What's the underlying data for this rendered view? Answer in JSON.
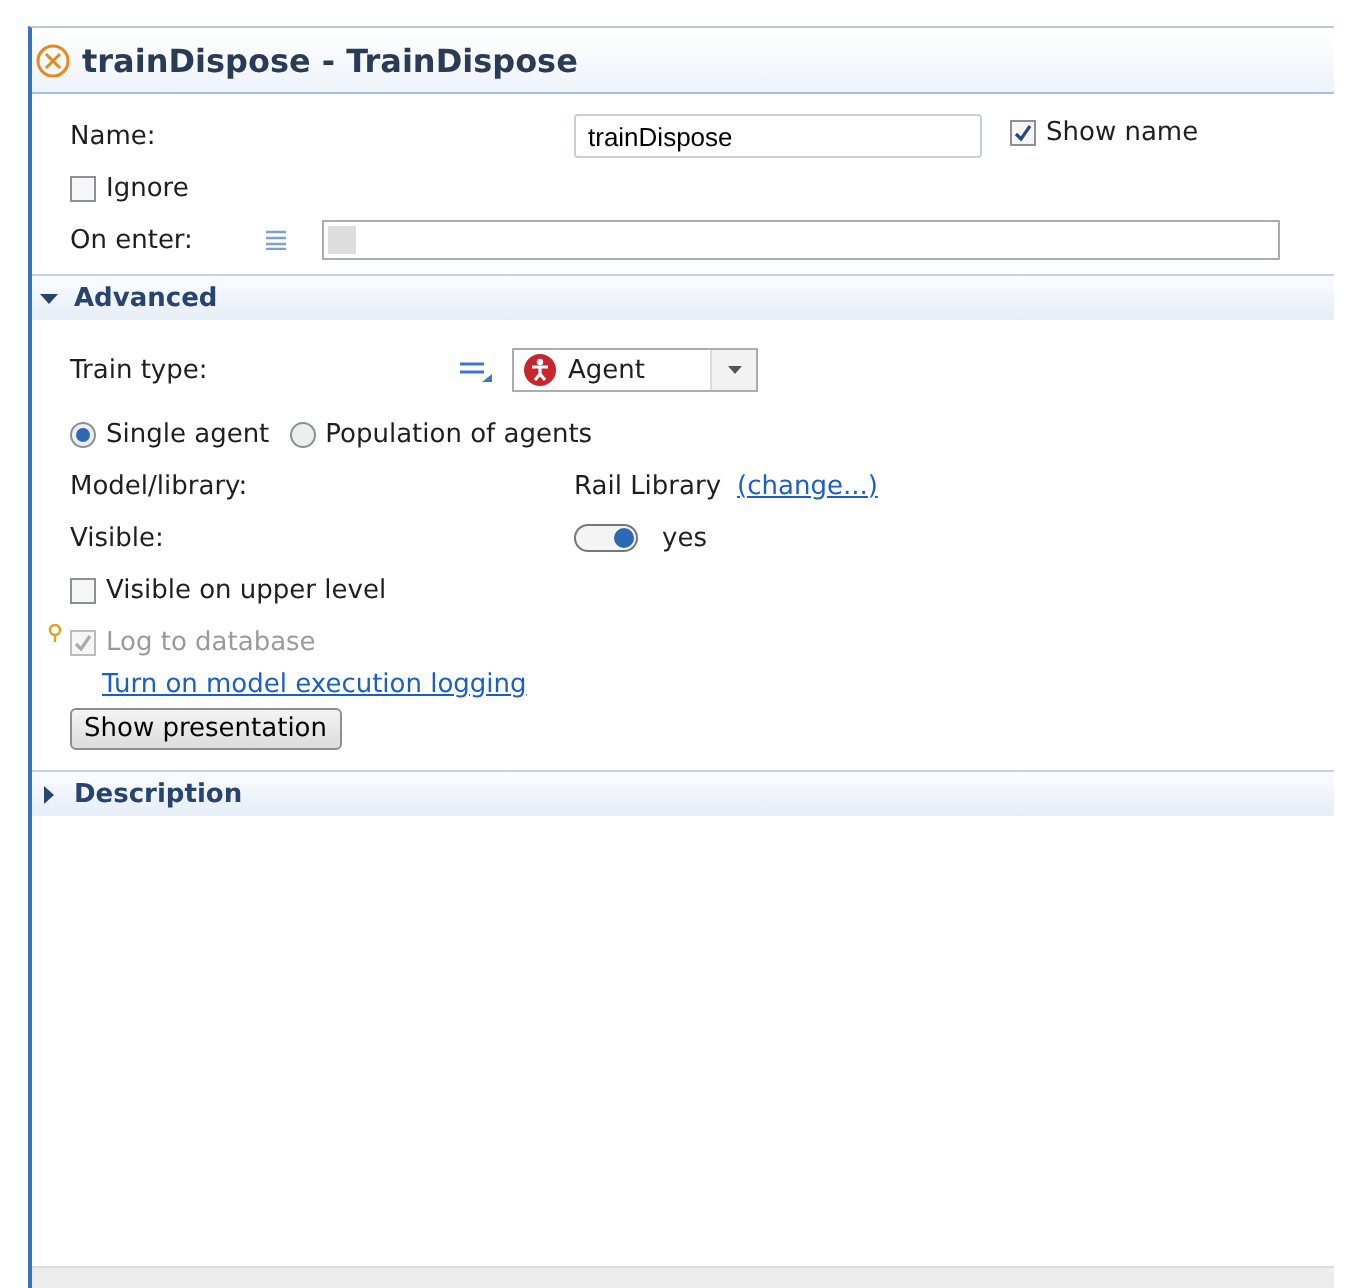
{
  "title": "trainDispose - TrainDispose",
  "name_field": {
    "label": "Name:",
    "value": "trainDispose"
  },
  "show_name": {
    "label": "Show name",
    "checked": true
  },
  "ignore": {
    "label": "Ignore",
    "checked": false
  },
  "on_enter": {
    "label": "On enter:"
  },
  "advanced": {
    "title": "Advanced",
    "expanded": true,
    "train_type": {
      "label": "Train type:",
      "value": "Agent"
    },
    "agent_options": [
      {
        "label": "Single agent",
        "selected": true
      },
      {
        "label": "Population of agents",
        "selected": false
      }
    ],
    "model_library": {
      "label": "Model/library:",
      "value": "Rail Library",
      "link": "(change...)"
    },
    "visible": {
      "label": "Visible:",
      "on": true,
      "value": "yes"
    },
    "visible_upper": {
      "label": "Visible on upper level",
      "checked": false
    },
    "log_to_database": {
      "label": "Log to database",
      "checked": true,
      "disabled": true
    },
    "logging_link": "Turn on model execution logging",
    "show_presentation": "Show presentation"
  },
  "description": {
    "title": "Description",
    "expanded": false
  }
}
